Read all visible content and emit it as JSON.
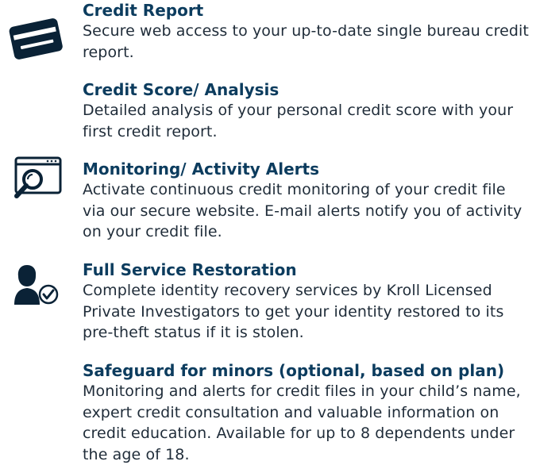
{
  "features": [
    {
      "icon": "credit-card-icon",
      "title": "Credit Report",
      "description": "Secure web access to your up-to-date single bureau credit report."
    },
    {
      "icon": "",
      "title": "Credit Score/ Analysis",
      "description": "Detailed analysis of your personal credit score with your first credit report."
    },
    {
      "icon": "magnifier-window-icon",
      "title": "Monitoring/ Activity Alerts",
      "description": "Activate continuous credit monitoring of your credit file via our secure website. E-mail alerts notify you of activity on your credit file."
    },
    {
      "icon": "person-check-icon",
      "title": "Full Service Restoration",
      "description": "Complete identity recovery services by Kroll Licensed Private Investigators to get your identity restored to its pre-theft status if it is stolen."
    },
    {
      "icon": "",
      "title": "Safeguard for minors (optional, based on plan)",
      "description": "Monitoring and alerts for credit files in your child’s name, expert credit consultation and valuable information on credit education. Available for up to 8 dependents under the age of 18."
    }
  ],
  "colors": {
    "title": "#0c3c5e",
    "text": "#1f2c39",
    "icon": "#0a2236"
  }
}
